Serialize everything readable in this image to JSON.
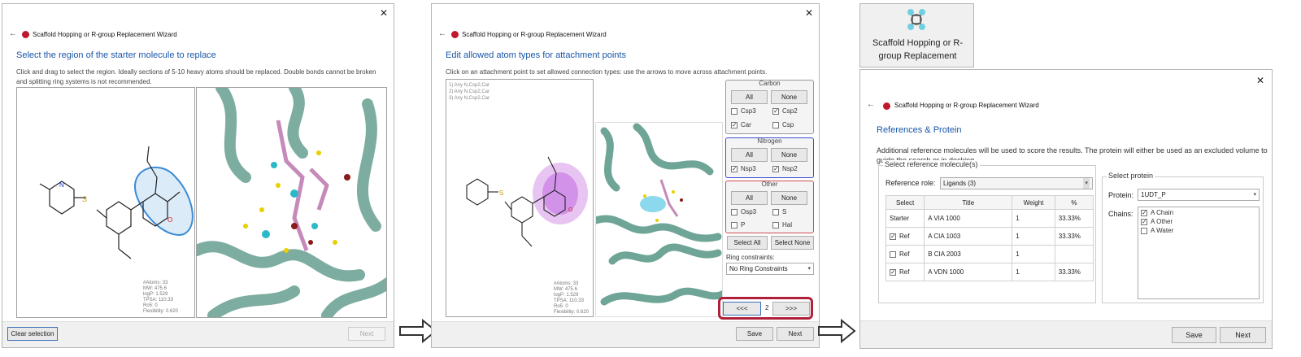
{
  "wizard_title": "Scaffold Hopping or R-group Replacement Wizard",
  "step1": {
    "heading": "Select the region of the starter molecule to replace",
    "description": "Click and drag to select the region. Ideally sections of 5-10 heavy atoms should be replaced. Double bonds cannot be broken and splitting ring systems is not recommended.",
    "clear_label": "Clear selection",
    "next_label": "Next",
    "props": [
      "#Atoms:   33",
      "MW:      475.6",
      "logP:    1.529",
      "TPSA:    110.33",
      "Ro5:     0",
      "Flexibility: 0.620"
    ]
  },
  "step2": {
    "heading": "Edit allowed atom types for attachment points",
    "description": "Click on an attachment point to set allowed connection types: use the arrows to move across attachment points.",
    "attachments": [
      "1) Any N,Csp2,Car",
      "2) Any N,Csp2,Car",
      "3) Any N,Csp2,Car"
    ],
    "carbon": {
      "title": "Carbon",
      "all": "All",
      "none": "None",
      "opts": [
        {
          "label": "Csp3",
          "checked": ""
        },
        {
          "label": "Csp2",
          "checked": "✓"
        },
        {
          "label": "Car",
          "checked": "✓"
        },
        {
          "label": "Csp",
          "checked": ""
        }
      ]
    },
    "nitrogen": {
      "title": "Nitrogen",
      "all": "All",
      "none": "None",
      "opts": [
        {
          "label": "Nsp3",
          "checked": "✓"
        },
        {
          "label": "Nsp2",
          "checked": "✓"
        }
      ]
    },
    "other": {
      "title": "Other",
      "all": "All",
      "none": "None",
      "opts": [
        {
          "label": "Osp3",
          "checked": ""
        },
        {
          "label": "S",
          "checked": ""
        },
        {
          "label": "P",
          "checked": ""
        },
        {
          "label": "Hal",
          "checked": ""
        }
      ]
    },
    "select_all": "Select All",
    "select_none": "Select None",
    "ring_label": "Ring constraints:",
    "ring_value": "No Ring Constraints",
    "prev_label": "<<<",
    "page": "2",
    "next_arrows": ">>>",
    "save_label": "Save",
    "next_label": "Next",
    "props": [
      "#Atoms:   33",
      "MW:      475.6",
      "logP:    1.529",
      "TPSA:    110.33",
      "Ro5:     0",
      "Flexibility: 0.620"
    ]
  },
  "tool_button": {
    "label": "Scaffold Hopping or R-group Replacement"
  },
  "step3": {
    "heading": "References & Protein",
    "description": "Additional reference molecules will be used to score the results.  The protein will either be used as an excluded volume to guide the search or in docking.",
    "ref_group": "Select reference molecule(s)",
    "ref_role_label": "Reference role:",
    "ref_role_value": "Ligands (3)",
    "columns": [
      "Select",
      "Title",
      "Weight",
      "%"
    ],
    "rows": [
      {
        "select": "Starter",
        "check": "",
        "title": "A VIA 1000",
        "weight": "1",
        "pct": "33.33%"
      },
      {
        "select": "Ref",
        "check": "✓",
        "title": "A CIA 1003",
        "weight": "1",
        "pct": "33.33%"
      },
      {
        "select": "Ref",
        "check": "",
        "title": "B CIA 2003",
        "weight": "1",
        "pct": ""
      },
      {
        "select": "Ref",
        "check": "✓",
        "title": "A VDN 1000",
        "weight": "1",
        "pct": "33.33%"
      }
    ],
    "protein_group": "Select protein",
    "protein_label": "Protein:",
    "protein_value": "1UDT_P",
    "chains_label": "Chains:",
    "chains": [
      {
        "label": "A Chain",
        "checked": "✓"
      },
      {
        "label": "A Other",
        "checked": "✓"
      },
      {
        "label": "A Water",
        "checked": ""
      }
    ],
    "save_label": "Save",
    "next_label": "Next"
  },
  "colors": {
    "accent": "#1a56a8",
    "highlight_red": "#b0203a",
    "nitrogen_blue": "#3a4ad0",
    "ribbon": "#6fa596"
  }
}
